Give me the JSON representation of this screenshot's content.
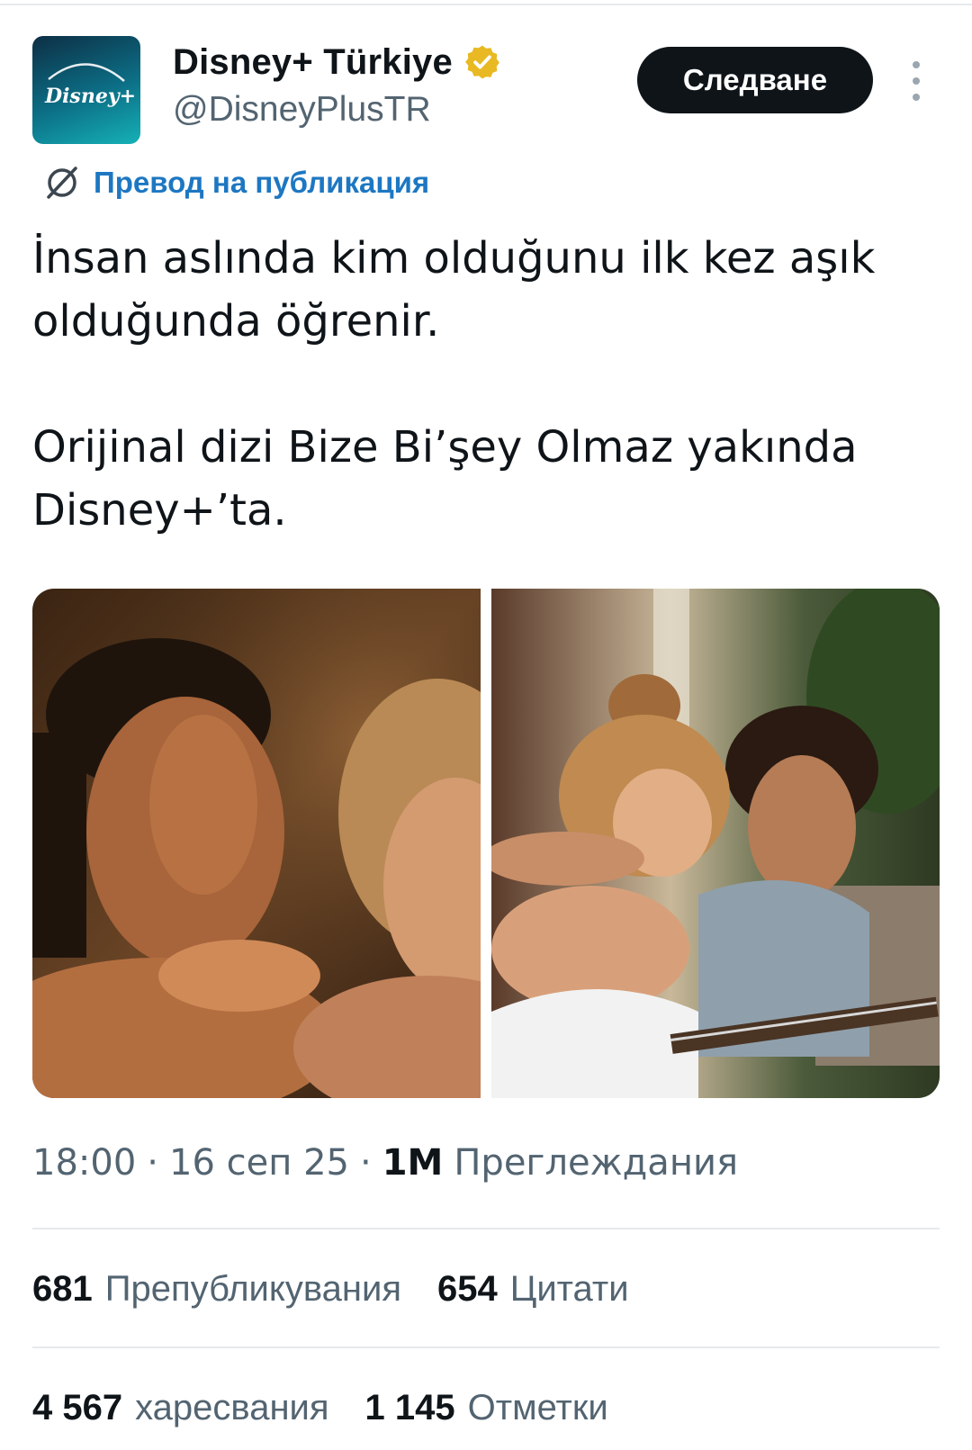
{
  "account": {
    "display_name": "Disney+ Türkiye",
    "handle": "@DisneyPlusTR",
    "verified_color": "#e8b923",
    "logo_text": "Disney+"
  },
  "actions": {
    "follow_label": "Следване"
  },
  "translate": {
    "label": "Превод на публикация",
    "color": "#1d77c2"
  },
  "tweet": {
    "paragraphs": [
      "İnsan aslında kim olduğunu ilk kez aşık olduğunda öğrenir.",
      "Orijinal dizi Bize Bi’şey Olmaz yakında Disney+’ta."
    ]
  },
  "media": {
    "photos": [
      {
        "description": "photo-couple-leaning"
      },
      {
        "description": "photo-couple-guitar"
      }
    ]
  },
  "meta": {
    "time": "18:00",
    "date": "16 сеп 25",
    "views_count": "1M",
    "views_label": "Преглеждания"
  },
  "stats": {
    "reposts_count": "681",
    "reposts_label": "Препубликувания",
    "quotes_count": "654",
    "quotes_label": "Цитати",
    "likes_count": "4 567",
    "likes_label": "харесвания",
    "bookmarks_count": "1 145",
    "bookmarks_label": "Отметки"
  }
}
